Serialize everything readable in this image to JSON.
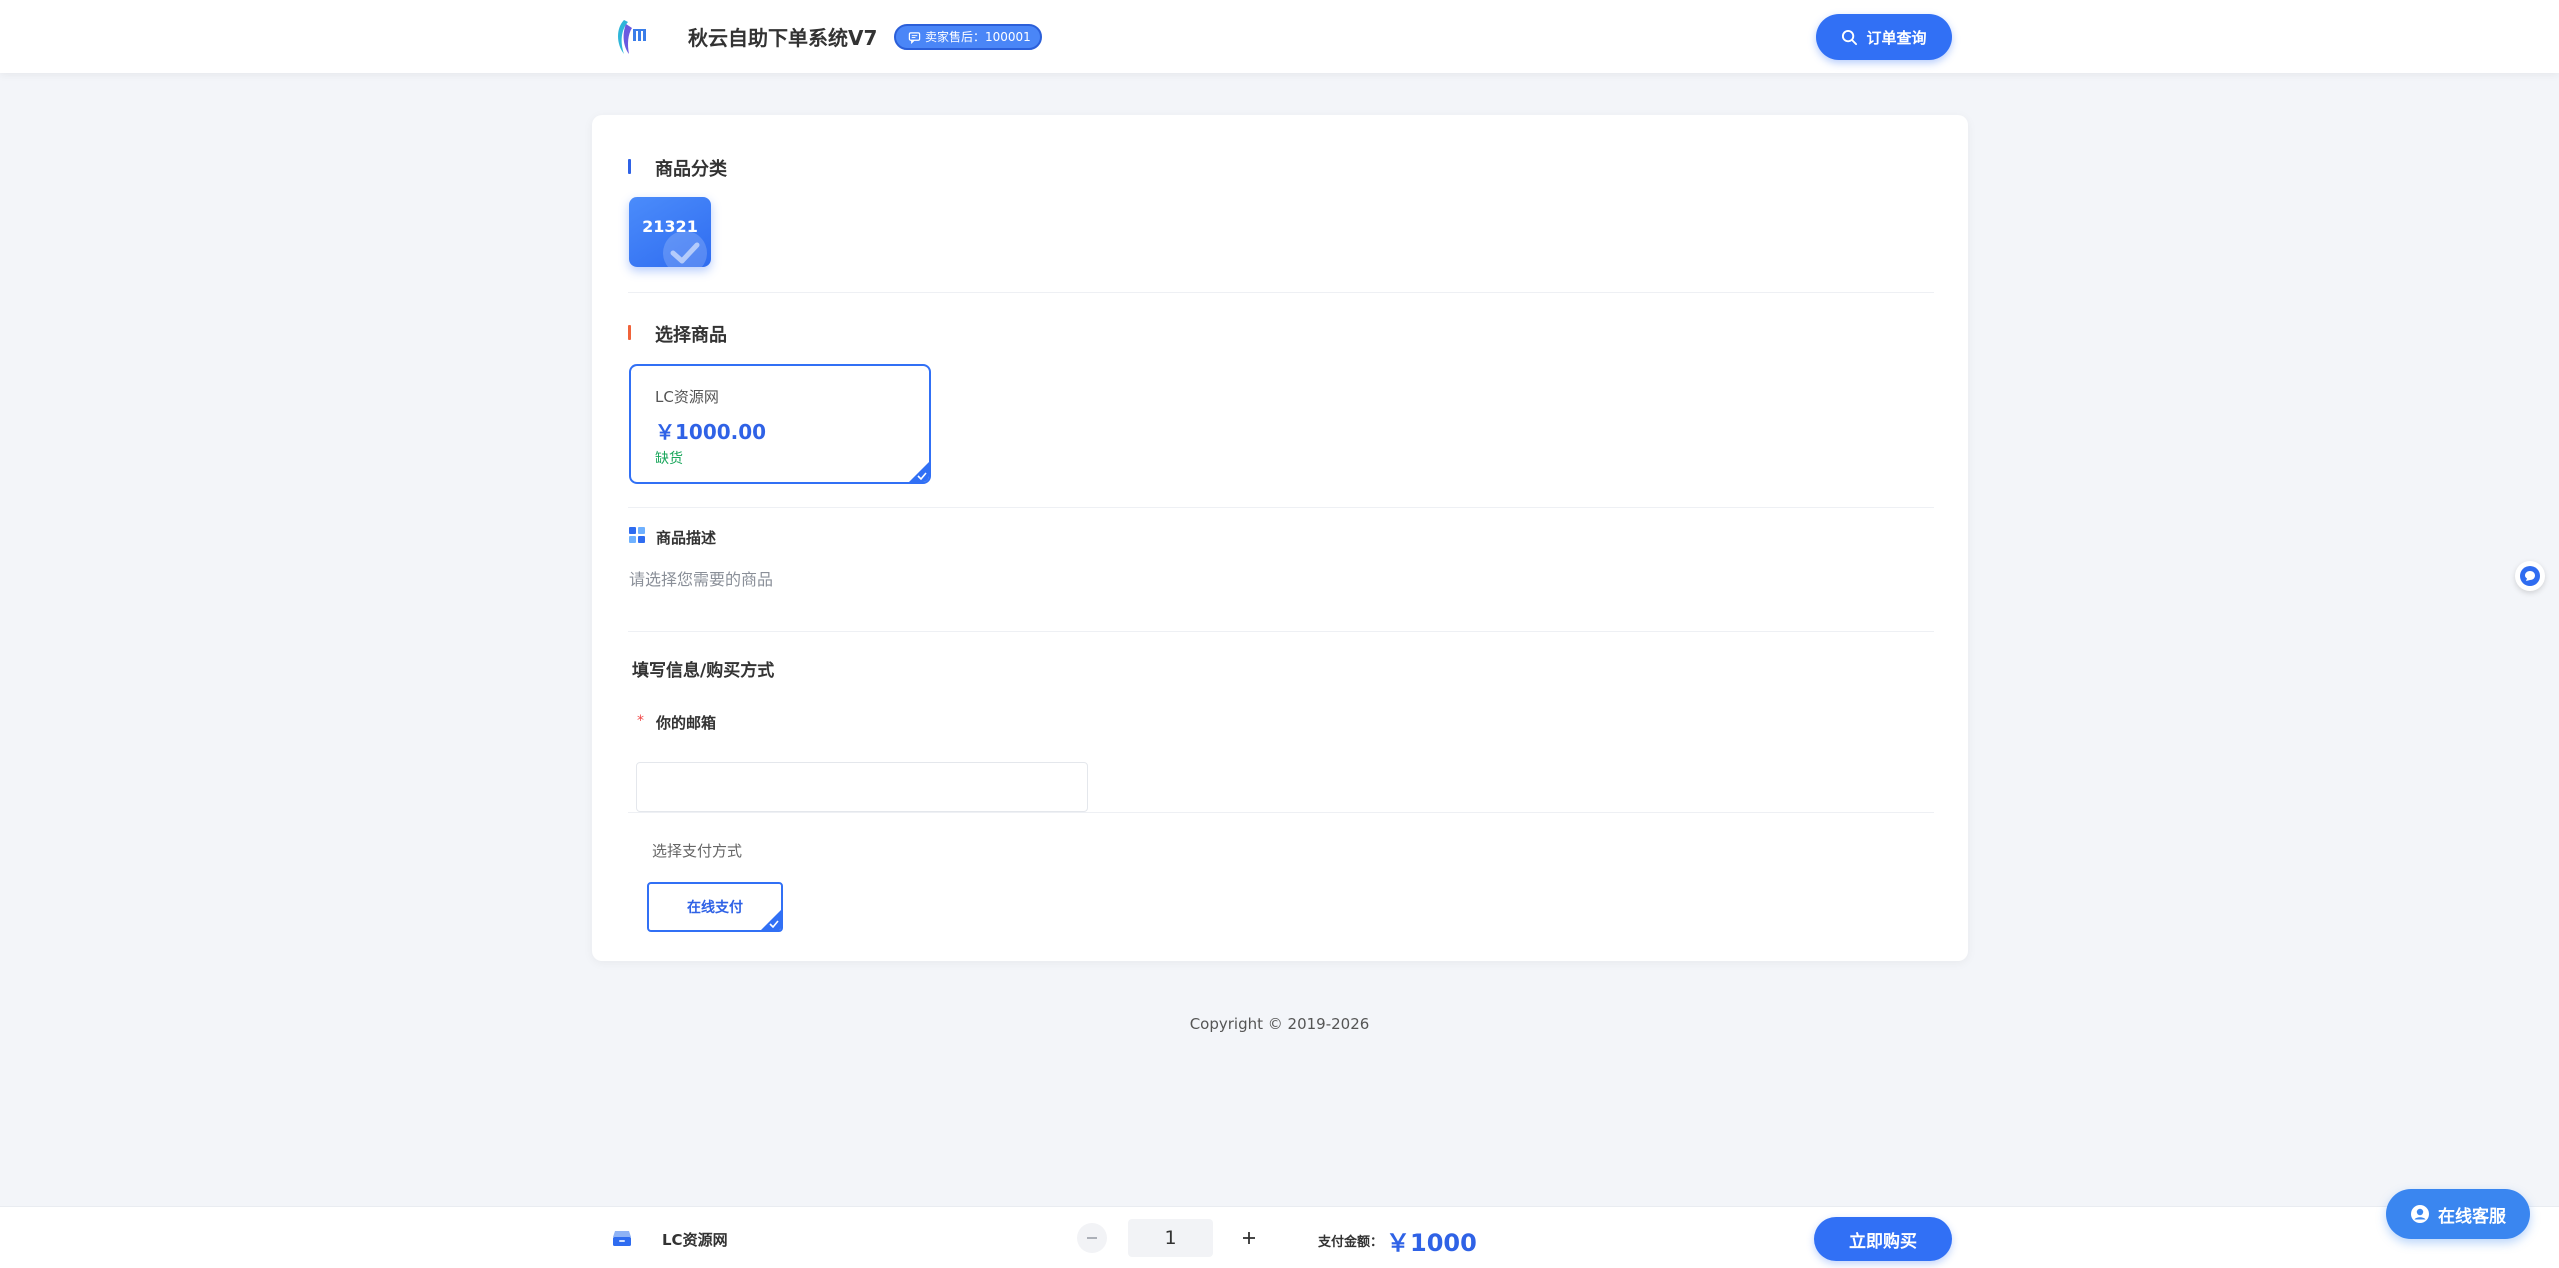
{
  "header": {
    "title": "秋云自助下单系统V7",
    "seller_badge": "卖家售后：100001",
    "order_query_label": "订单查询"
  },
  "categories": {
    "title": "商品分类",
    "items": [
      {
        "label": "21321",
        "selected": true
      }
    ]
  },
  "products": {
    "title": "选择商品",
    "items": [
      {
        "name": "LC资源网",
        "price": "￥1000.00",
        "stock": "缺货",
        "selected": true
      }
    ]
  },
  "description": {
    "title": "商品描述",
    "text": "请选择您需要的商品"
  },
  "form": {
    "title": "填写信息/购买方式",
    "required_mark": "*",
    "email_label": "你的邮箱",
    "email_value": "",
    "email_placeholder": "",
    "payment_title": "选择支付方式",
    "payment_options": [
      {
        "label": "在线支付",
        "selected": true
      }
    ]
  },
  "footer": {
    "copyright": "Copyright © 2019-2026"
  },
  "bottom_bar": {
    "product_name": "LC资源网",
    "quantity": "1",
    "pay_label": "支付金额：",
    "pay_amount": "￥1000",
    "buy_label": "立即购买"
  },
  "service": {
    "label": "在线客服"
  },
  "colors": {
    "primary": "#3170f5",
    "price": "#2f62e6",
    "stock": "#19a65b",
    "category_bar": "#2f62e6",
    "product_bar": "#f0633a",
    "required": "#f04646"
  },
  "icons": {
    "logo": "logo-icon",
    "seller": "chat-bubble-icon",
    "search": "search-icon",
    "check": "check-icon",
    "description": "grid-icon",
    "product": "box-icon",
    "minus": "minus-icon",
    "plus": "plus-icon",
    "service": "headset-icon",
    "float": "chat-float-icon"
  }
}
